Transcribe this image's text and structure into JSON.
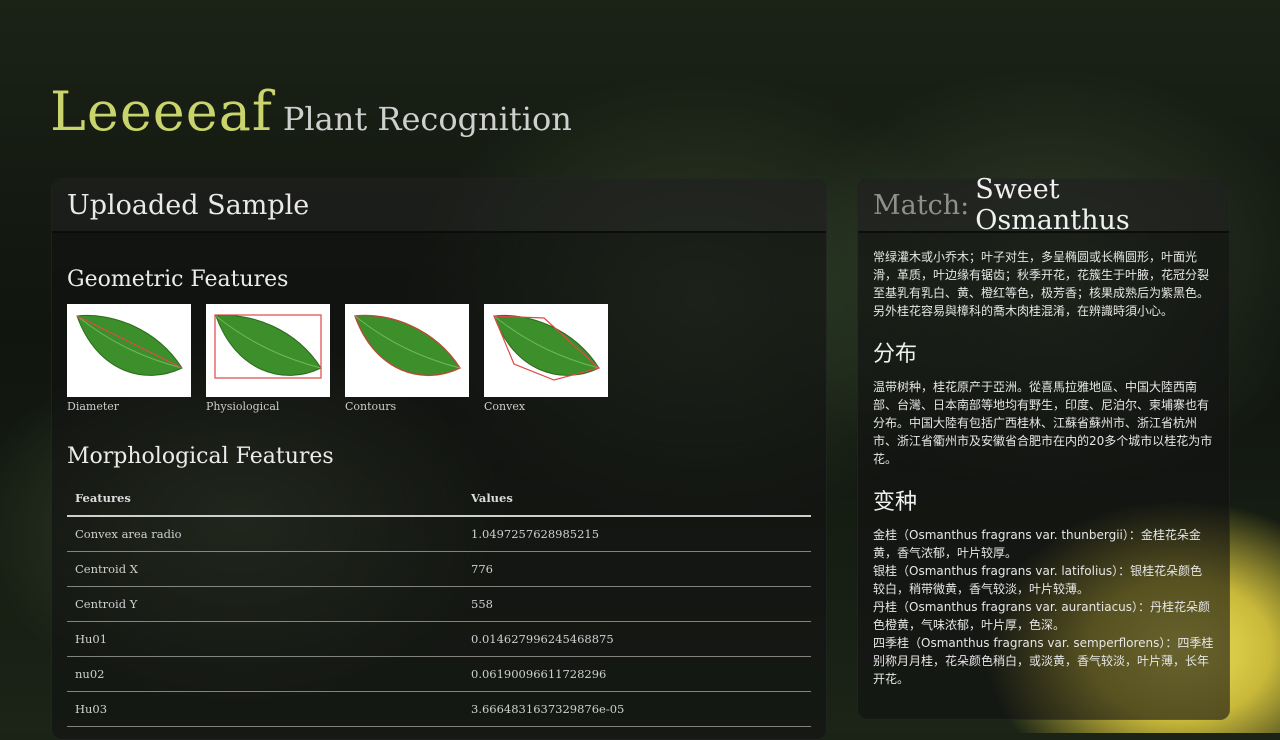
{
  "app": {
    "brand": "Leeeeaf",
    "subtitle": "Plant Recognition"
  },
  "sample": {
    "title": "Uploaded Sample",
    "geometric": {
      "title": "Geometric Features",
      "items": [
        {
          "label": "Diameter"
        },
        {
          "label": "Physiological"
        },
        {
          "label": "Contours"
        },
        {
          "label": "Convex"
        }
      ]
    },
    "morphological": {
      "title": "Morphological Features",
      "headers": {
        "features": "Features",
        "values": "Values"
      },
      "rows": [
        {
          "feature": "Convex area radio",
          "value": "1.0497257628985215"
        },
        {
          "feature": "Centroid X",
          "value": "776"
        },
        {
          "feature": "Centroid Y",
          "value": "558"
        },
        {
          "feature": "Hu01",
          "value": "0.014627996245468875"
        },
        {
          "feature": "nu02",
          "value": "0.06190096611728296"
        },
        {
          "feature": "Hu03",
          "value": "3.6664831637329876e-05"
        }
      ]
    }
  },
  "match": {
    "prefix": "Match:",
    "name": "Sweet Osmanthus",
    "description": "常绿灌木或小乔木；叶子对生，多呈椭圆或长椭圆形，叶面光滑，革质，叶边缘有锯齿；秋季开花，花簇生于叶腋，花冠分裂至基乳有乳白、黄、橙红等色，极芳香；核果成熟后为紫黑色。",
    "note": "另外桂花容易與樟科的喬木肉桂混淆，在辨識時須小心。",
    "distribution": {
      "title": "分布",
      "text": "温带树种，桂花原产于亞洲。從喜馬拉雅地區、中国大陸西南部、台灣、日本南部等地均有野生，印度、尼泊尔、柬埔寨也有分布。中国大陸有包括广西桂林、江蘇省蘇州市、浙江省杭州市、浙江省衢州市及安徽省合肥市在内的20多个城市以桂花为市花。"
    },
    "varieties": {
      "title": "变种",
      "items": [
        "金桂（Osmanthus fragrans var. thunbergii）：金桂花朵金黄，香气浓郁，叶片较厚。",
        "银桂（Osmanthus fragrans var. latifolius）：银桂花朵颜色较白，稍带微黄，香气较淡，叶片较薄。",
        "丹桂（Osmanthus fragrans var. aurantiacus）：丹桂花朵颜色橙黄，气味浓郁，叶片厚，色深。",
        "四季桂（Osmanthus fragrans var. semperflorens）：四季桂别称月月桂，花朵颜色稍白，或淡黄，香气较淡，叶片薄，长年开花。"
      ]
    }
  },
  "colors": {
    "brand": "#c9d56c",
    "panel": "rgba(18,18,18,0.62)",
    "overlay_red": "#e04848"
  }
}
